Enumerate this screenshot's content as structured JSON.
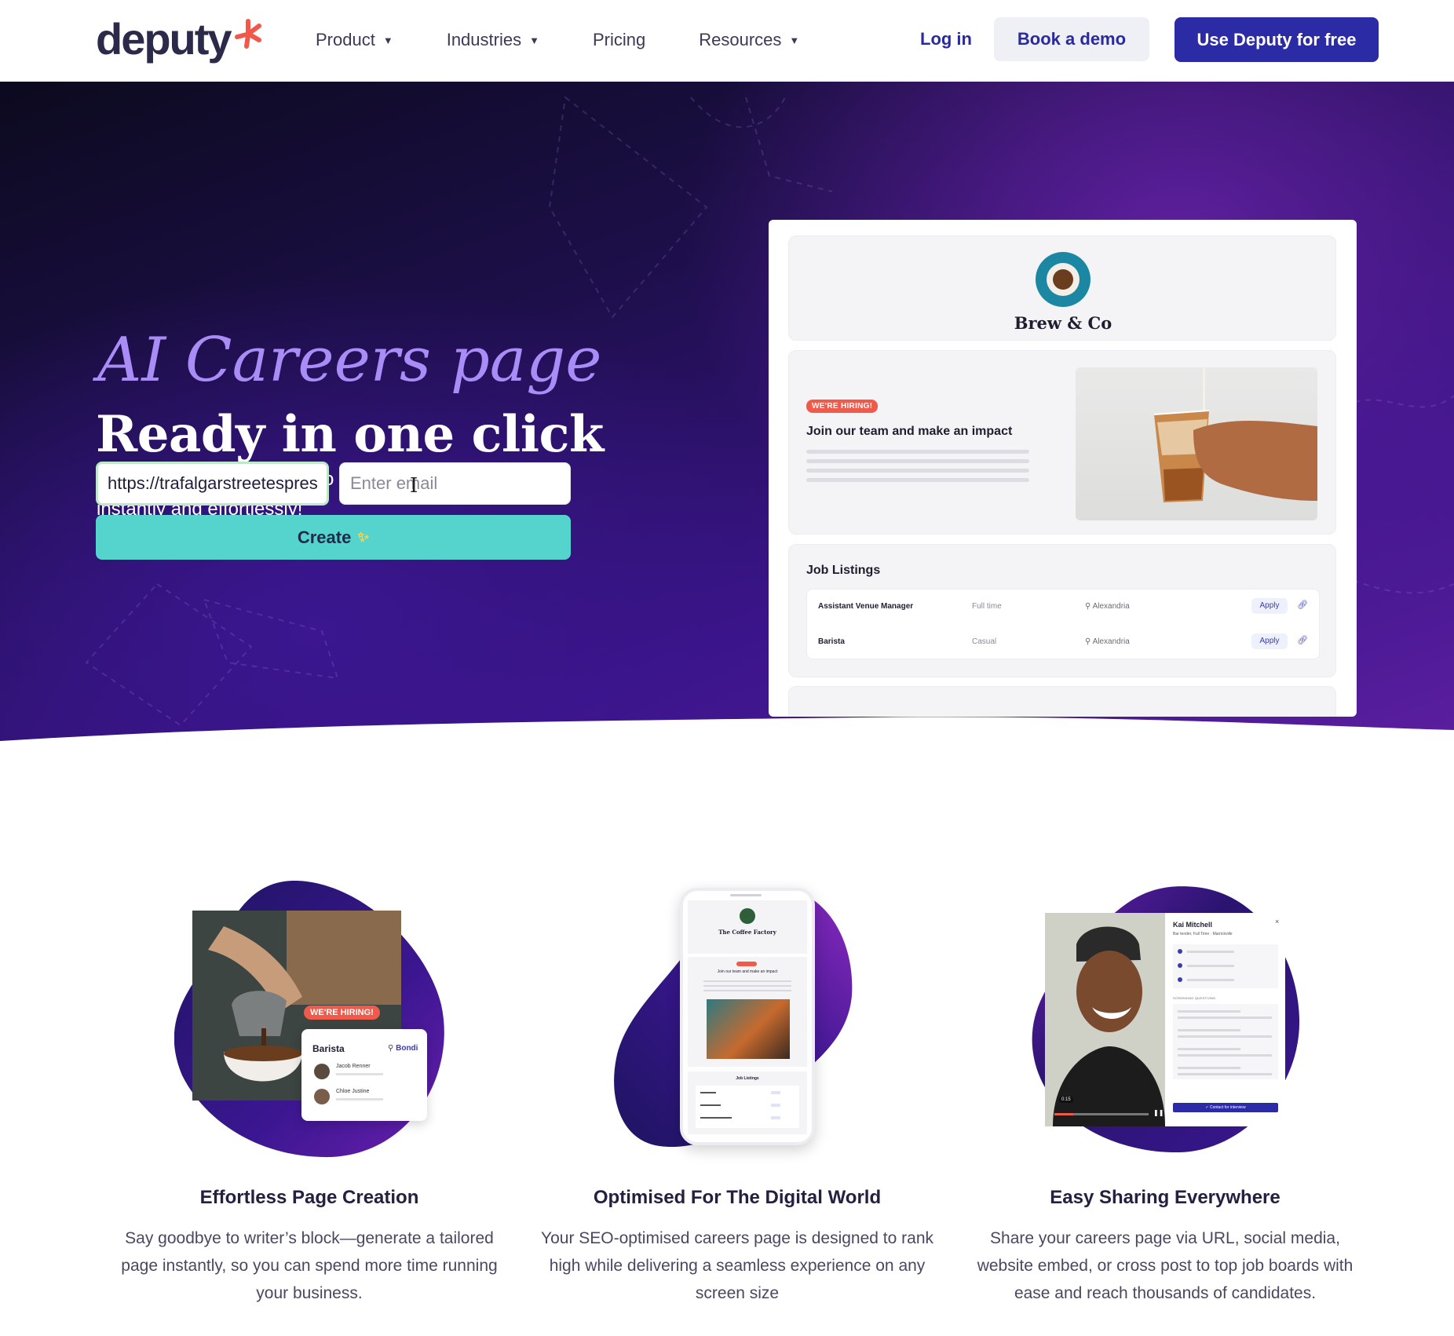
{
  "nav": {
    "logo_text": "deputy",
    "links": [
      {
        "label": "Product",
        "has_caret": true
      },
      {
        "label": "Industries",
        "has_caret": true
      },
      {
        "label": "Pricing",
        "has_caret": false
      },
      {
        "label": "Resources",
        "has_caret": true
      }
    ],
    "login_label": "Log in",
    "demo_label": "Book a demo",
    "free_label": "Use Deputy for free"
  },
  "hero": {
    "script_title": "AI Careers page",
    "title": "Ready in one click",
    "subtitle": "Turn your business URL into a tailored careers page—instantly and effortlessly!",
    "url_value": "https://trafalgarstreetespres",
    "email_placeholder": "Enter email",
    "create_label": "Create",
    "create_icon": "sparkles-icon"
  },
  "preview": {
    "brand": "Brew & Co",
    "badge": "WE'RE HIRING!",
    "join_text": "Join our team and make an impact",
    "jobs_title": "Job Listings",
    "jobs": [
      {
        "role": "Assistant Venue Manager",
        "type": "Full time",
        "location": "Alexandria",
        "apply": "Apply"
      },
      {
        "role": "Barista",
        "type": "Casual",
        "location": "Alexandria",
        "apply": "Apply"
      }
    ]
  },
  "illustrations": {
    "one": {
      "badge": "WE'RE HIRING!",
      "card_title": "Barista",
      "card_location": "Bondi",
      "people": [
        "Jacob Renner",
        "Chloe Justine"
      ]
    },
    "two": {
      "brand": "The Coffee Factory",
      "join_text": "Join our team and make an impact",
      "jobs_title": "Job Listings"
    },
    "three": {
      "name": "Kai Mitchell",
      "meta": "Bar tender, Full Time · Marrickville",
      "section": "SCREENING QUESTIONS",
      "cta": "✓ Contact for interview",
      "time": "0:15"
    }
  },
  "features": [
    {
      "title": "Effortless Page Creation",
      "desc": "Say goodbye to writer’s block—generate a tailored page instantly, so you can spend more time running your business."
    },
    {
      "title": "Optimised For The Digital World",
      "desc": "Your SEO-optimised careers page is designed to rank high while delivering a seamless experience on any screen size"
    },
    {
      "title": "Easy Sharing Everywhere",
      "desc": "Share your careers page via URL, social media, website embed, or cross post to top job boards with ease and reach thousands of candidates."
    }
  ],
  "colors": {
    "brand_primary": "#2b2ba6",
    "accent_teal": "#55d3cd",
    "logo_mark": "#f0584a",
    "hero_purple": "#5a1e9e",
    "script_lavender": "#a98cf5"
  }
}
